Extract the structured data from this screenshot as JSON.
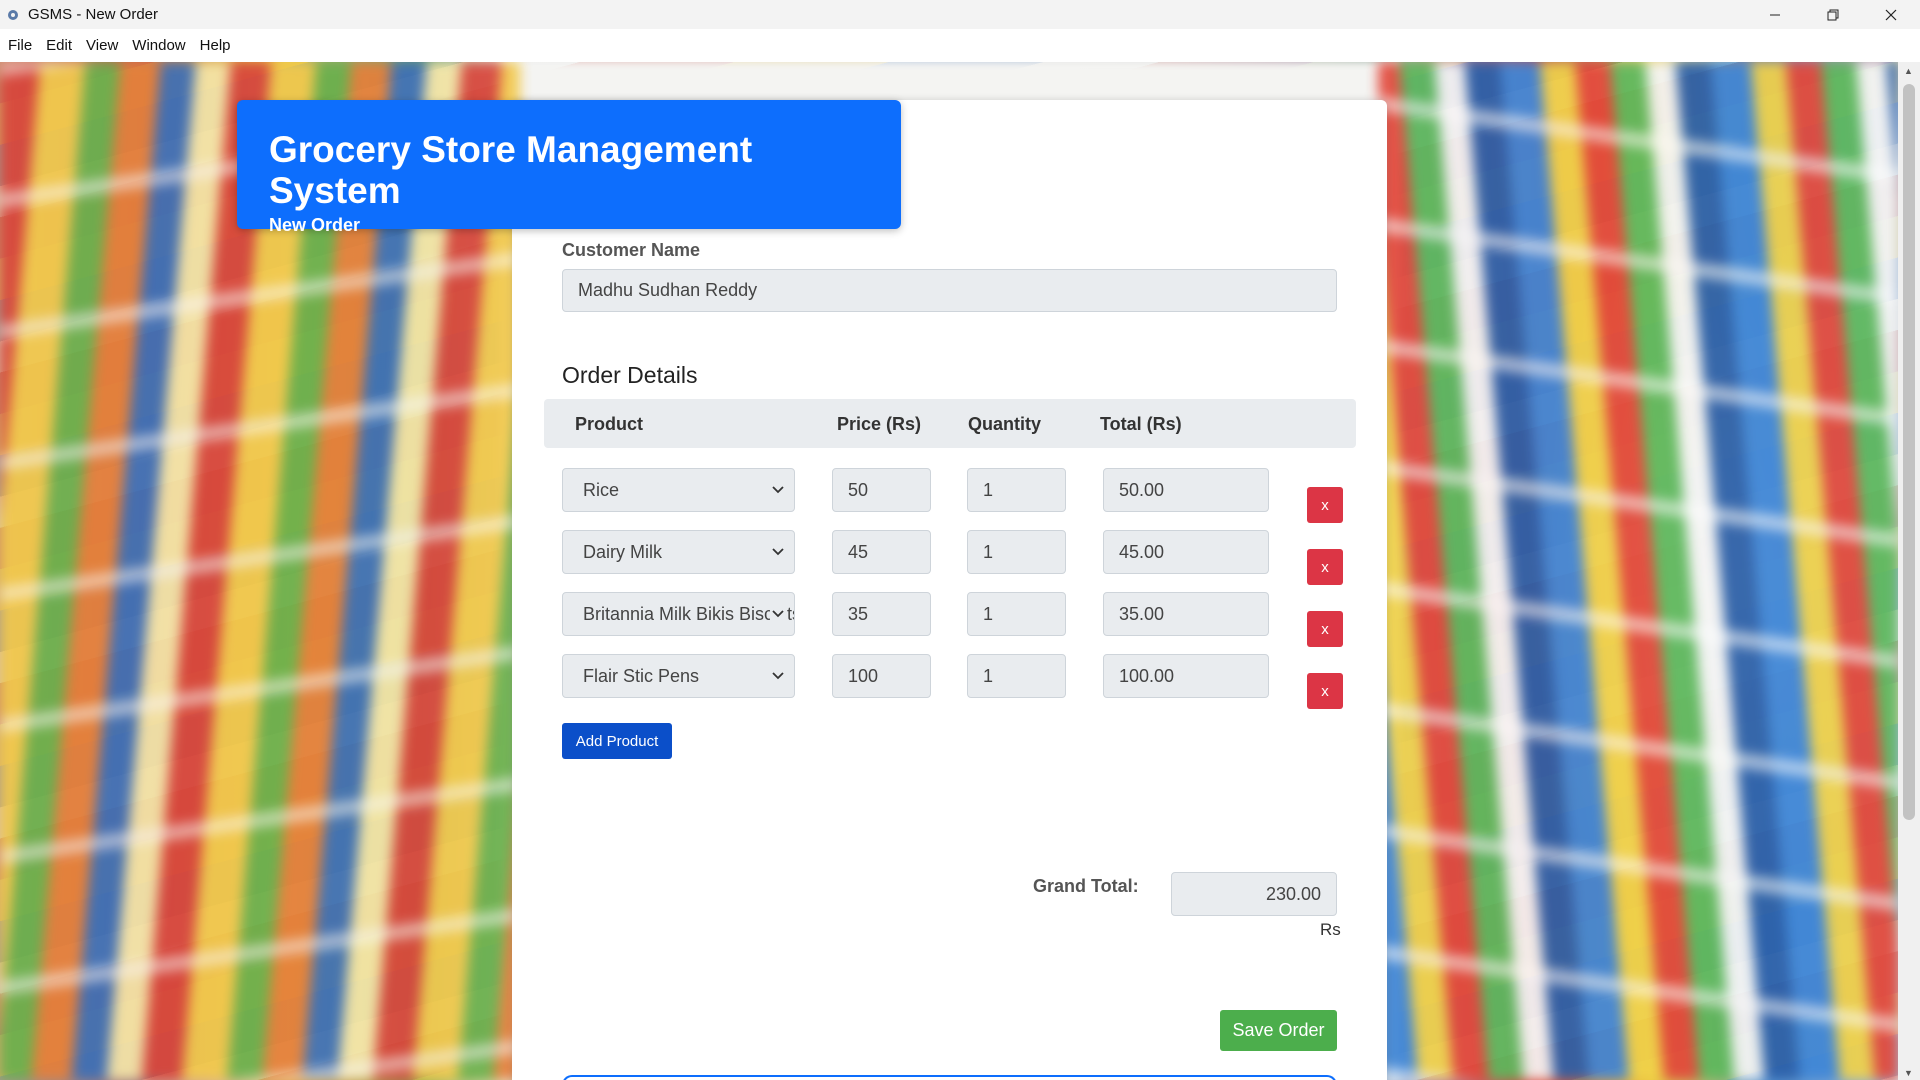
{
  "window": {
    "title": "GSMS - New Order",
    "app_icon": "gear-icon",
    "controls": [
      "minimize-icon",
      "restore-icon",
      "close-icon"
    ]
  },
  "menu": {
    "items": [
      {
        "label": "File"
      },
      {
        "label": "Edit"
      },
      {
        "label": "View"
      },
      {
        "label": "Window"
      },
      {
        "label": "Help"
      }
    ]
  },
  "header": {
    "title": "Grocery Store Management System",
    "subtitle": "New Order",
    "color": "#0d6efd"
  },
  "customer": {
    "label": "Customer Name",
    "value": "Madhu Sudhan Reddy"
  },
  "order": {
    "section_title": "Order Details",
    "columns": [
      "Product",
      "Price (Rs)",
      "Quantity",
      "Total (Rs)"
    ],
    "rows": [
      {
        "product": "Rice",
        "price": "50",
        "quantity": "1",
        "total": "50.00",
        "remove_label": "x"
      },
      {
        "product": "Dairy Milk",
        "price": "45",
        "quantity": "1",
        "total": "45.00",
        "remove_label": "x"
      },
      {
        "product": "Britannia Milk Bikis Biscuits",
        "price": "35",
        "quantity": "1",
        "total": "35.00",
        "remove_label": "x"
      },
      {
        "product": "Flair Stic Pens",
        "price": "100",
        "quantity": "1",
        "total": "100.00",
        "remove_label": "x"
      }
    ],
    "add_label": "Add Product"
  },
  "summary": {
    "grand_total_label": "Grand Total:",
    "grand_total_value": "230.00",
    "currency": "Rs"
  },
  "actions": {
    "save_label": "Save Order",
    "save_color": "#4cae4c",
    "remove_color": "#dc3545"
  }
}
